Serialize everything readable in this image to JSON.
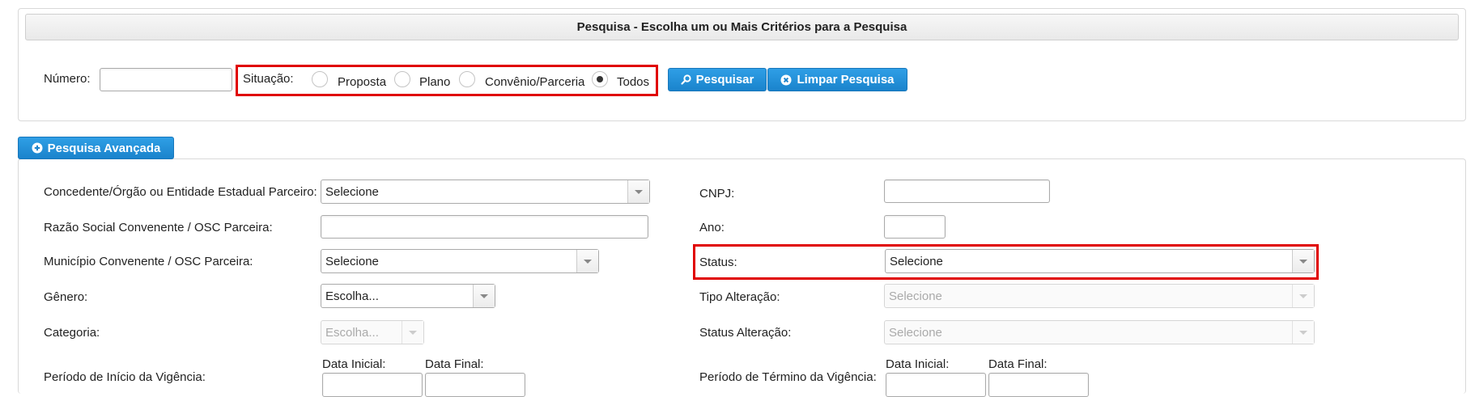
{
  "search_panel": {
    "title": "Pesquisa - Escolha um ou Mais Critérios para a Pesquisa",
    "numero_label": "Número:",
    "numero_value": "",
    "situacao_label": "Situação:",
    "situacao_options": [
      "Proposta",
      "Plano",
      "Convênio/Parceria",
      "Todos"
    ],
    "situacao_selected": "Todos",
    "search_button": "Pesquisar",
    "clear_button": "Limpar Pesquisa"
  },
  "advanced": {
    "toggle_label": "Pesquisa Avançada",
    "concedente_label": "Concedente/Órgão ou Entidade Estadual Parceiro:",
    "concedente_value": "Selecione",
    "razao_label": "Razão Social Convenente / OSC Parceira:",
    "razao_value": "",
    "municipio_label": "Município Convenente / OSC Parceira:",
    "municipio_value": "Selecione",
    "genero_label": "Gênero:",
    "genero_value": "Escolha...",
    "categoria_label": "Categoria:",
    "categoria_value": "Escolha...",
    "periodo_inicio_label": "Período de Início da Vigência:",
    "data_inicial_label": "Data Inicial:",
    "data_final_label": "Data Final:",
    "cnpj_label": "CNPJ:",
    "cnpj_value": "",
    "ano_label": "Ano:",
    "ano_value": "",
    "status_label": "Status:",
    "status_value": "Selecione",
    "tipo_alteracao_label": "Tipo Alteração:",
    "tipo_alteracao_value": "Selecione",
    "status_alteracao_label": "Status Alteração:",
    "status_alteracao_value": "Selecione",
    "periodo_termino_label": "Período de Término da Vigência:"
  },
  "colors": {
    "accent": "#1a83cc",
    "highlight": "#e00000"
  }
}
